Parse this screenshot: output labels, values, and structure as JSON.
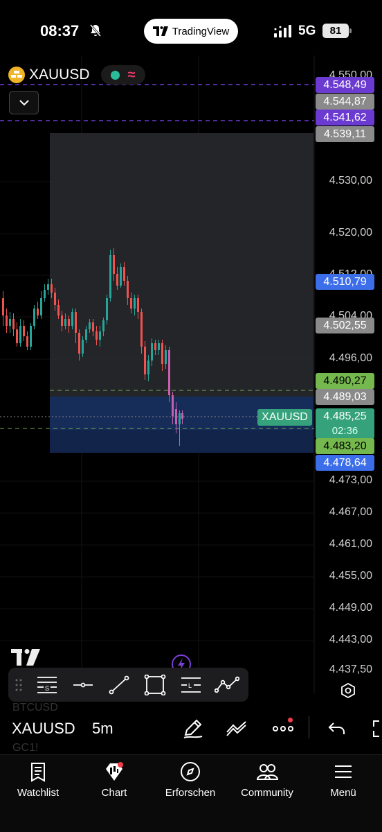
{
  "status": {
    "time": "08:37",
    "app_pill": "TradingView",
    "network": "5G",
    "battery": "81"
  },
  "symbol": {
    "name": "XAUUSD",
    "bottom_name": "XAUUSD",
    "timeframe": "5m",
    "ghost_top": "BTCUSD",
    "ghost_bottom": "GC1!"
  },
  "axis_labels": [
    "4.550,00",
    "4.530,00",
    "4.520,00",
    "4.512,00",
    "4.504,00",
    "4.496,00",
    "4.473,00",
    "4.467,00",
    "4.461,00",
    "4.455,00",
    "4.449,00",
    "4.443,00",
    "4.437,50"
  ],
  "price_tags": {
    "p1": "4.548,49",
    "p2": "4.544,87",
    "p3": "4.541,62",
    "p4": "4.539,11",
    "p5": "4.510,79",
    "p6": "4.502,55",
    "p7": "4.490,27",
    "p8": "4.489,03",
    "p9": "4.483,20",
    "p10": "4.478,64"
  },
  "current_price": {
    "symbol_tag": "XAUUSD",
    "price": "4.485,25",
    "countdown": "02:36"
  },
  "colors": {
    "up": "#26a69a",
    "down": "#ef5350",
    "wick_pink": "#c85fb0",
    "purple": "#6a3ad1",
    "teal": "#35a27c",
    "blue": "#3d6eea"
  },
  "drawing_tools": [
    "drag-handle-icon",
    "fib-retracement-icon",
    "horizontal-line-icon",
    "trend-line-icon",
    "rectangle-icon",
    "horizontal-ray-icon",
    "pattern-icon"
  ],
  "nav": {
    "watchlist": "Watchlist",
    "chart": "Chart",
    "explore": "Erforschen",
    "community": "Community",
    "menu": "Menü"
  }
}
